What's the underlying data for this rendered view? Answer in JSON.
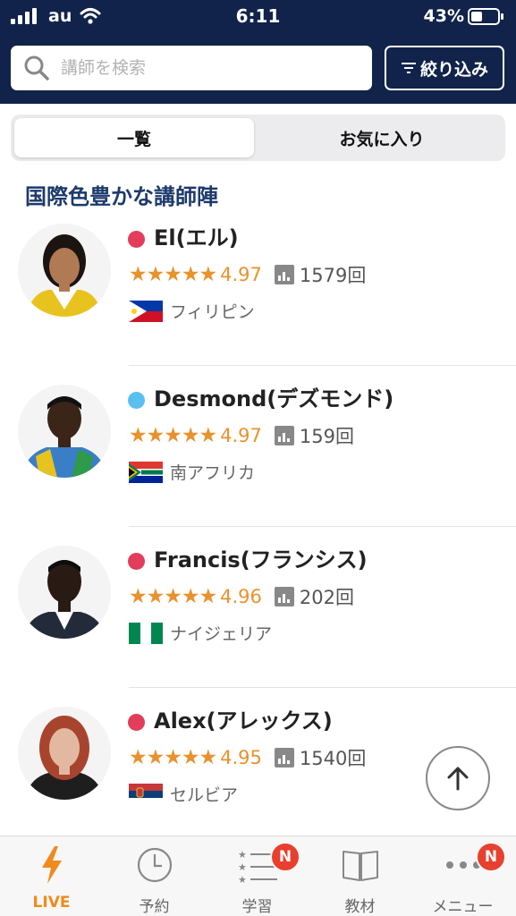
{
  "status_bar": {
    "carrier": "au",
    "time": "6:11",
    "battery_percent": "43%",
    "battery_level": 0.43
  },
  "search": {
    "placeholder": "講師を検索",
    "filter_label": "絞り込み"
  },
  "segments": {
    "items": [
      {
        "label": "一覧",
        "selected": true
      },
      {
        "label": "お気に入り",
        "selected": false
      }
    ]
  },
  "section_title": "国際色豊かな講師陣",
  "teachers": [
    {
      "name": "El(エル)",
      "status_color": "#e23d5a",
      "stars": "★★★★★",
      "rating": "4.97",
      "lessons": "1579回",
      "country": "フィリピン",
      "flag": "philippines"
    },
    {
      "name": "Desmond(デズモンド)",
      "status_color": "#5bc0f0",
      "stars": "★★★★★",
      "rating": "4.97",
      "lessons": "159回",
      "country": "南アフリカ",
      "flag": "south-africa"
    },
    {
      "name": "Francis(フランシス)",
      "status_color": "#e23d5a",
      "stars": "★★★★★",
      "rating": "4.96",
      "lessons": "202回",
      "country": "ナイジェリア",
      "flag": "nigeria"
    },
    {
      "name": "Alex(アレックス)",
      "status_color": "#e23d5a",
      "stars": "★★★★★",
      "rating": "4.95",
      "lessons": "1540回",
      "country": "セルビア",
      "flag": "serbia"
    }
  ],
  "tabbar": {
    "items": [
      {
        "label": "LIVE",
        "icon": "lightning-icon",
        "active": true,
        "badge": ""
      },
      {
        "label": "予約",
        "icon": "clock-icon",
        "active": false,
        "badge": ""
      },
      {
        "label": "学習",
        "icon": "list-icon",
        "active": false,
        "badge": "N"
      },
      {
        "label": "教材",
        "icon": "book-icon",
        "active": false,
        "badge": ""
      },
      {
        "label": "メニュー",
        "icon": "more-icon",
        "active": false,
        "badge": "N"
      }
    ]
  },
  "colors": {
    "header_bg": "#11234a",
    "accent": "#f08a1d",
    "star": "#e8922e",
    "section_title": "#1d3a6b",
    "badge": "#e8402e"
  }
}
